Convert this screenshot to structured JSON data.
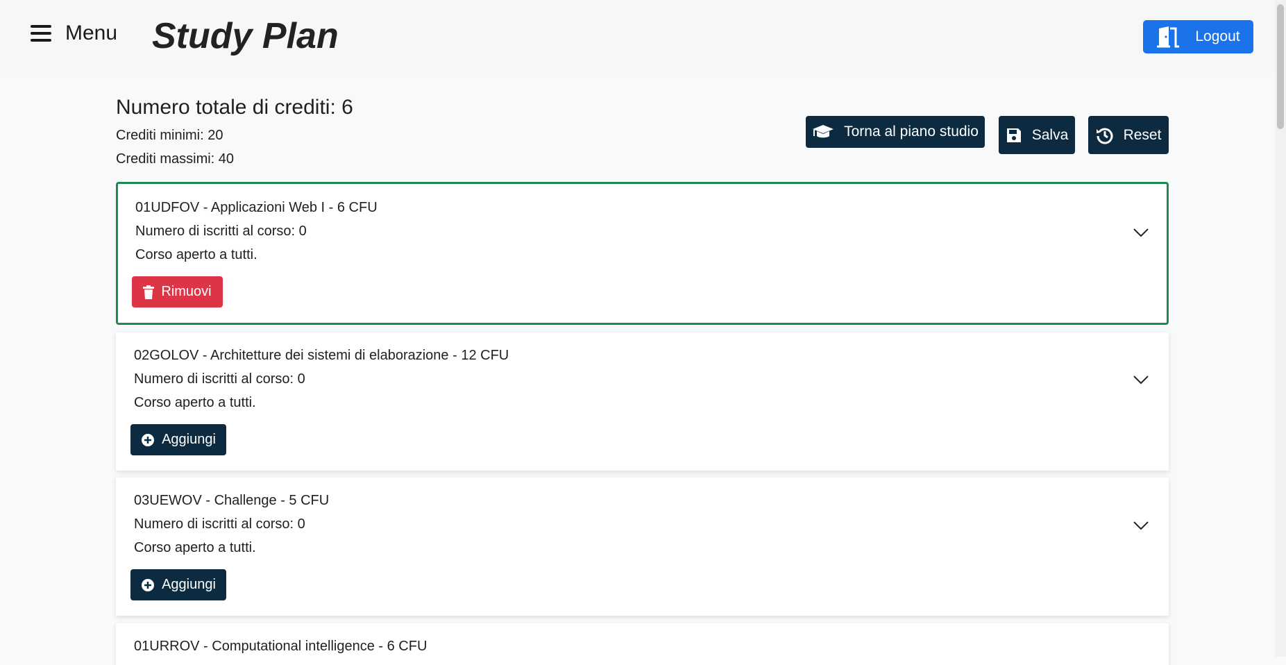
{
  "navbar": {
    "menu_label": "Menu",
    "brand": "Study Plan",
    "logout_label": "Logout"
  },
  "summary": {
    "total_credits": "Numero totale di crediti: 6",
    "min_credits": "Crediti minimi: 20",
    "max_credits": "Crediti massimi: 40"
  },
  "actions": {
    "back_label": "Torna al piano studio",
    "save_label": "Salva",
    "reset_label": "Reset"
  },
  "courses": [
    {
      "title": "01UDFOV - Applicazioni Web I - 6 CFU",
      "enrolled": "Numero di iscritti al corso: 0",
      "availability": "Corso aperto a tutti.",
      "action_label": "Rimuovi",
      "selected": true
    },
    {
      "title": "02GOLOV - Architetture dei sistemi di elaborazione - 12 CFU",
      "enrolled": "Numero di iscritti al corso: 0",
      "availability": "Corso aperto a tutti.",
      "action_label": "Aggiungi",
      "selected": false
    },
    {
      "title": "03UEWOV - Challenge - 5 CFU",
      "enrolled": "Numero di iscritti al corso: 0",
      "availability": "Corso aperto a tutti.",
      "action_label": "Aggiungi",
      "selected": false
    },
    {
      "title": "01URROV - Computational intelligence - 6 CFU",
      "selected": false
    }
  ],
  "icons": {
    "menu": "hamburger-icon",
    "logout": "door-icon",
    "back": "graduation-cap-icon",
    "save": "floppy-disk-icon",
    "reset": "history-icon",
    "remove": "trash-icon",
    "add": "plus-circle-icon",
    "expand": "chevron-down-icon"
  },
  "colors": {
    "primary": "#1a73e8",
    "dark": "#0d2b40",
    "danger": "#dc3545",
    "selected_border": "#1e8a4f"
  }
}
